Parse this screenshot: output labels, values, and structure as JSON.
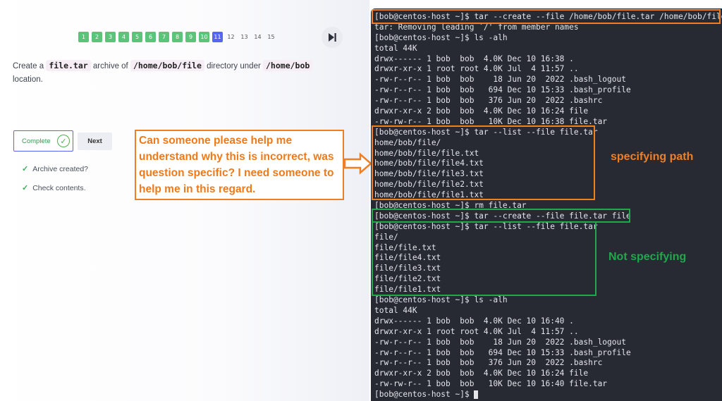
{
  "progress": {
    "steps": [
      "1",
      "2",
      "3",
      "4",
      "5",
      "6",
      "7",
      "8",
      "9",
      "10",
      "11",
      "12",
      "13",
      "14",
      "15"
    ],
    "completed_count": 10,
    "current_step": "11"
  },
  "task": {
    "text_1": "Create a ",
    "code_1": "file.tar",
    "text_2": " archive of ",
    "code_2": "/home/bob/file",
    "text_3": " directory under ",
    "code_3": "/home/bob",
    "text_4": "location."
  },
  "actions": {
    "complete_label": "Complete",
    "next_label": "Next"
  },
  "checks": [
    {
      "label": "Archive created?"
    },
    {
      "label": "Check contents."
    }
  ],
  "annotations": {
    "note": "Can someone please help me understand why this is incorrect, was question specific? I need someone to help me in this regard.",
    "specifying_path": "specifying path",
    "not_specifying": "Not specifying"
  },
  "terminal": {
    "lines": [
      "[bob@centos-host ~]$ tar --create --file /home/bob/file.tar /home/bob/file",
      "tar: Removing leading `/' from member names",
      "[bob@centos-host ~]$ ls -alh",
      "total 44K",
      "drwx------ 1 bob  bob  4.0K Dec 10 16:38 .",
      "drwxr-xr-x 1 root root 4.0K Jul  4 11:57 ..",
      "-rw-r--r-- 1 bob  bob    18 Jun 20  2022 .bash_logout",
      "-rw-r--r-- 1 bob  bob   694 Dec 10 15:33 .bash_profile",
      "-rw-r--r-- 1 bob  bob   376 Jun 20  2022 .bashrc",
      "drwxr-xr-x 2 bob  bob  4.0K Dec 10 16:24 file",
      "-rw-rw-r-- 1 bob  bob   10K Dec 10 16:38 file.tar",
      "[bob@centos-host ~]$ tar --list --file file.tar",
      "home/bob/file/",
      "home/bob/file/file.txt",
      "home/bob/file/file4.txt",
      "home/bob/file/file3.txt",
      "home/bob/file/file2.txt",
      "home/bob/file/file1.txt",
      "[bob@centos-host ~]$ rm file.tar",
      "[bob@centos-host ~]$ tar --create --file file.tar file",
      "[bob@centos-host ~]$ tar --list --file file.tar",
      "file/",
      "file/file.txt",
      "file/file4.txt",
      "file/file3.txt",
      "file/file2.txt",
      "file/file1.txt",
      "[bob@centos-host ~]$ ls -alh",
      "total 44K",
      "drwx------ 1 bob  bob  4.0K Dec 10 16:40 .",
      "drwxr-xr-x 1 root root 4.0K Jul  4 11:57 ..",
      "-rw-r--r-- 1 bob  bob    18 Jun 20  2022 .bash_logout",
      "-rw-r--r-- 1 bob  bob   694 Dec 10 15:33 .bash_profile",
      "-rw-r--r-- 1 bob  bob   376 Jun 20  2022 .bashrc",
      "drwxr-xr-x 2 bob  bob  4.0K Dec 10 16:24 file",
      "-rw-rw-r-- 1 bob  bob   10K Dec 10 16:40 file.tar",
      "[bob@centos-host ~]$ "
    ]
  },
  "colors": {
    "accent": "#5865f2",
    "done_step": "#5cc47a",
    "annotation_orange": "#f07f24",
    "annotation_green": "#20a84a",
    "terminal_bg": "#272a33"
  }
}
